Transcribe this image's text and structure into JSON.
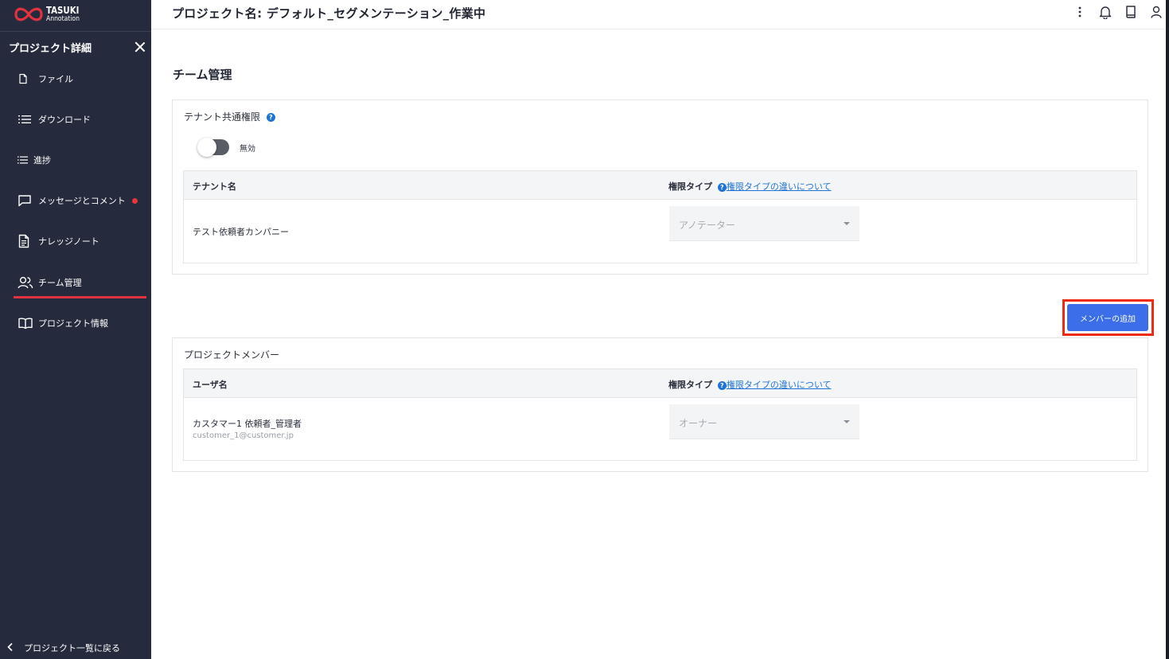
{
  "logo": {
    "name": "TASUKI",
    "sub": "Annotation",
    "icon": "tasuki-logo-icon"
  },
  "sidebar": {
    "title": "プロジェクト詳細",
    "items": [
      {
        "label": "ファイル",
        "icon": "file-icon"
      },
      {
        "label": "ダウンロード",
        "icon": "list-icon"
      },
      {
        "label": "進捗",
        "icon": "list-icon"
      },
      {
        "label": "メッセージとコメント",
        "icon": "message-icon",
        "unread": true
      },
      {
        "label": "ナレッジノート",
        "icon": "document-icon"
      },
      {
        "label": "チーム管理",
        "icon": "team-icon",
        "active": true
      },
      {
        "label": "プロジェクト情報",
        "icon": "book-icon"
      }
    ],
    "back_label": "プロジェクト一覧に戻る"
  },
  "header": {
    "title": "プロジェクト名: デフォルト_セグメンテーション_作業中",
    "icons": [
      "more-vertical-icon",
      "bell-icon",
      "book-icon",
      "user-icon"
    ]
  },
  "main": {
    "section_title": "チーム管理",
    "tenant_card": {
      "label": "テナント共通権限",
      "toggle_label": "無効",
      "toggle_on": false,
      "columns": {
        "name": "テナント名",
        "role": "権限タイプ",
        "role_link": "権限タイプの違いについて"
      },
      "rows": [
        {
          "name": "テスト依頼者カンパニー",
          "role": "アノテーター"
        }
      ]
    },
    "add_member_label": "メンバーの追加",
    "member_card": {
      "label": "プロジェクトメンバー",
      "columns": {
        "name": "ユーザ名",
        "role": "権限タイプ",
        "role_link": "権限タイプの違いについて"
      },
      "rows": [
        {
          "name": "カスタマー1 依頼者_管理者",
          "email": "customer_1@customer.jp",
          "role": "オーナー"
        }
      ]
    }
  },
  "colors": {
    "sidebar_bg": "#252b3d",
    "accent_red": "#e0333f",
    "button_blue": "#3b6ee8",
    "link_blue": "#1f75d6",
    "highlight": "#ee2a15"
  }
}
